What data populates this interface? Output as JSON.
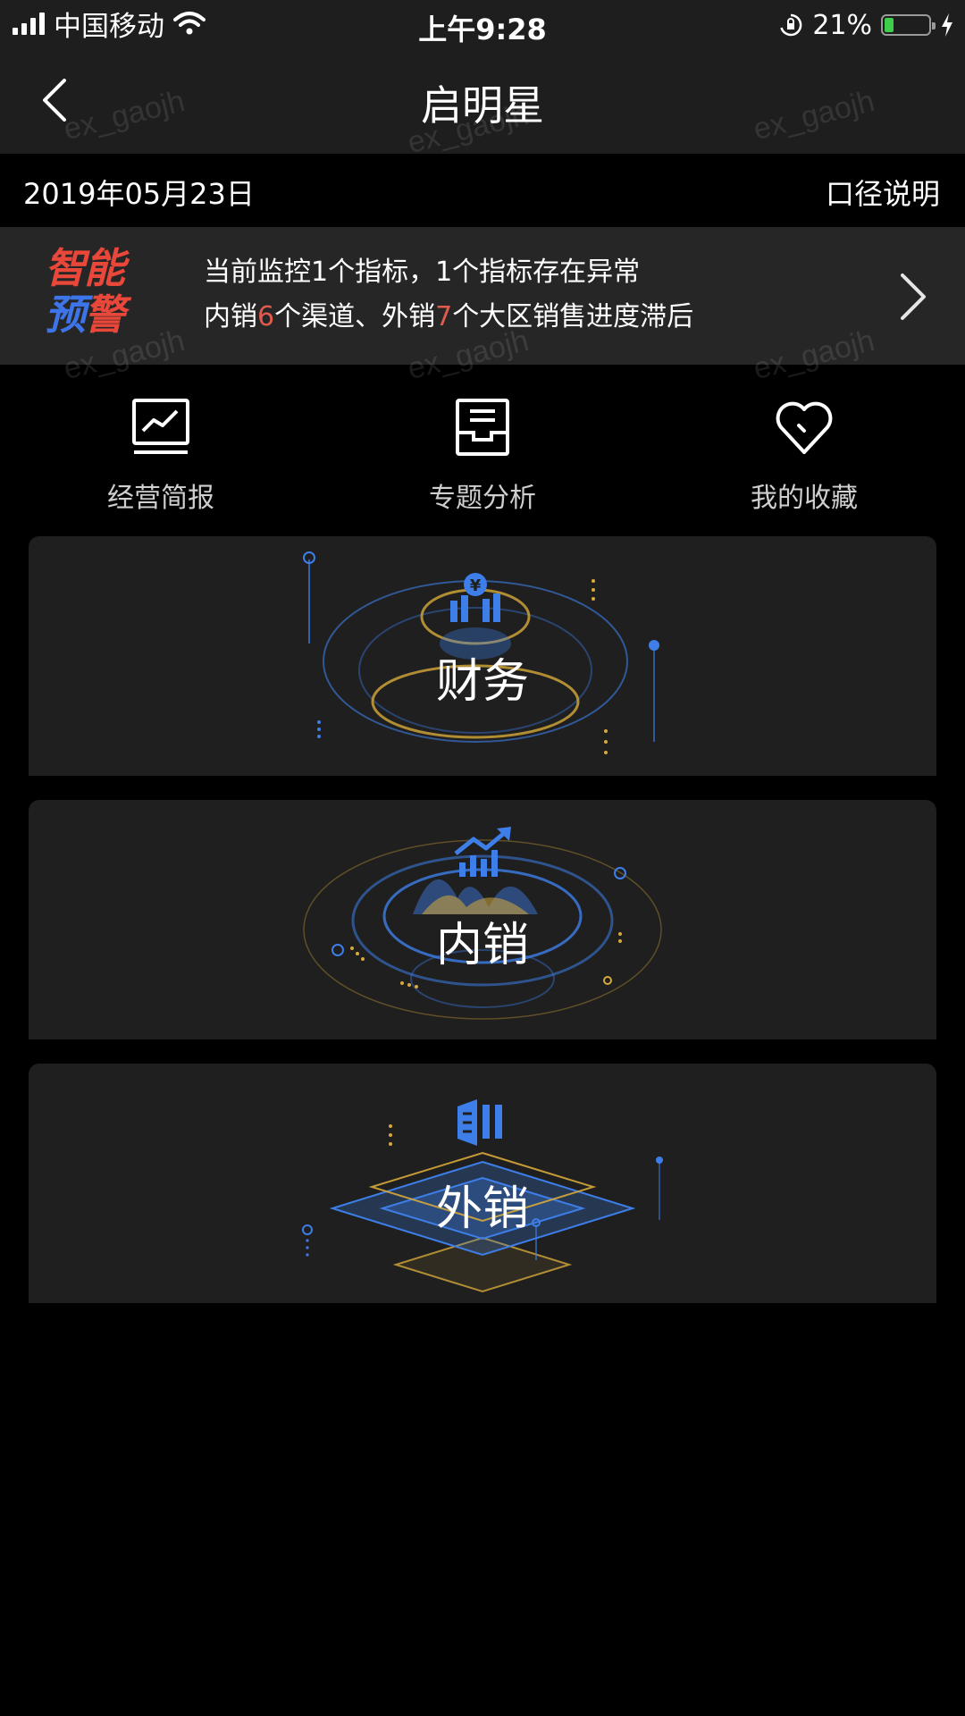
{
  "status_bar": {
    "carrier": "中国移动",
    "time": "上午9:28",
    "battery": "21%",
    "battery_level": 0.21,
    "icons": [
      "signal-icon",
      "wifi-icon",
      "rotation-lock-icon",
      "battery-icon",
      "charging-icon"
    ]
  },
  "nav": {
    "title": "启明星",
    "back_icon": "chevron-left-icon"
  },
  "watermark": "ex_gaojh",
  "date_row": {
    "date": "2019年05月23日",
    "caliber_label": "口径说明"
  },
  "alert": {
    "logo_line1": "智能",
    "logo_line2_a": "预",
    "logo_line2_b": "警",
    "line1": "当前监控1个指标，1个指标存在异常",
    "line2_a": "内销",
    "line2_num1": "6",
    "line2_b": "个渠道、外销",
    "line2_num2": "7",
    "line2_c": "个大区销售进度滞后",
    "arrow_icon": "chevron-right-icon"
  },
  "entries": [
    {
      "label": "经营简报",
      "icon": "line-chart-icon"
    },
    {
      "label": "专题分析",
      "icon": "inbox-icon"
    },
    {
      "label": "我的收藏",
      "icon": "heart-icon"
    }
  ],
  "modules": [
    {
      "title": "财务",
      "icon": "yuan-bar-chart-icon"
    },
    {
      "title": "内销",
      "icon": "trend-up-chart-icon"
    },
    {
      "title": "外销",
      "icon": "ship-bar-chart-icon"
    }
  ],
  "colors": {
    "accent_blue": "#3d7ee8",
    "accent_gold": "#d6a93a",
    "alert_red": "#e05a4d",
    "card_bg": "#1f1f1f"
  }
}
